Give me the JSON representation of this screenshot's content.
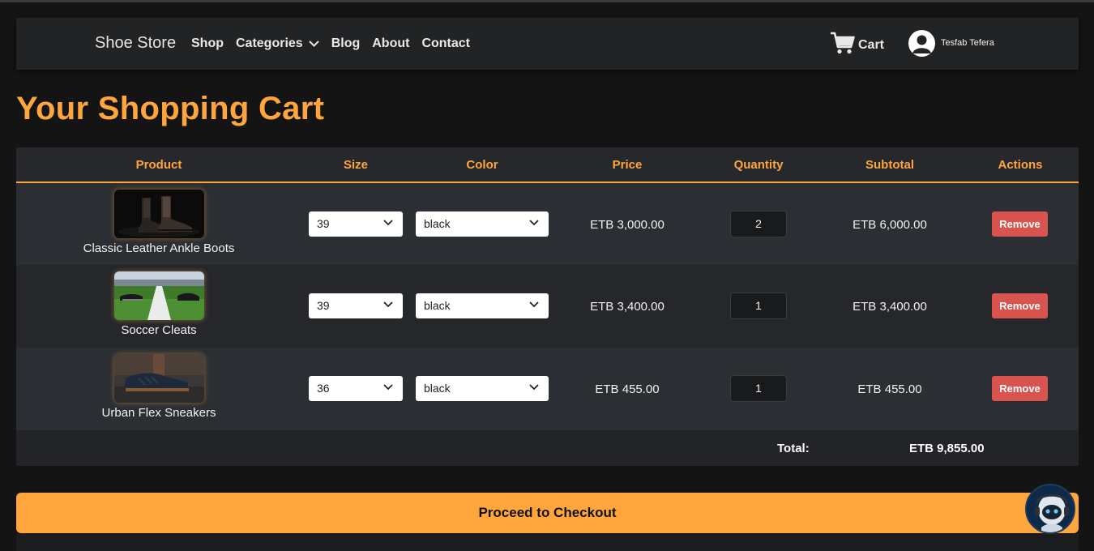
{
  "navbar": {
    "brand": "Shoe Store",
    "links": [
      "Shop",
      "Categories",
      "Blog",
      "About",
      "Contact"
    ],
    "cart_label": "Cart",
    "user_name": "Tesfab Tefera"
  },
  "page_title": "Your Shopping Cart",
  "table": {
    "headers": [
      "Product",
      "Size",
      "Color",
      "Price",
      "Quantity",
      "Subtotal",
      "Actions"
    ],
    "rows": [
      {
        "product": "Classic Leather Ankle Boots",
        "size": "39",
        "color": "black",
        "price": "ETB 3,000.00",
        "quantity": "2",
        "subtotal": "ETB 6,000.00",
        "action": "Remove"
      },
      {
        "product": "Soccer Cleats",
        "size": "39",
        "color": "black",
        "price": "ETB 3,400.00",
        "quantity": "1",
        "subtotal": "ETB 3,400.00",
        "action": "Remove"
      },
      {
        "product": "Urban Flex Sneakers",
        "size": "36",
        "color": "black",
        "price": "ETB 455.00",
        "quantity": "1",
        "subtotal": "ETB 455.00",
        "action": "Remove"
      }
    ],
    "total_label": "Total:",
    "total_value": "ETB 9,855.00"
  },
  "checkout_label": "Proceed to Checkout",
  "colors": {
    "accent": "#ffa53e",
    "remove": "#d9534f",
    "background": "#141414",
    "navbar": "#222325"
  },
  "icons": [
    "chevron-down-icon",
    "cart-icon",
    "user-avatar-icon",
    "chatbot-robot-icon"
  ]
}
